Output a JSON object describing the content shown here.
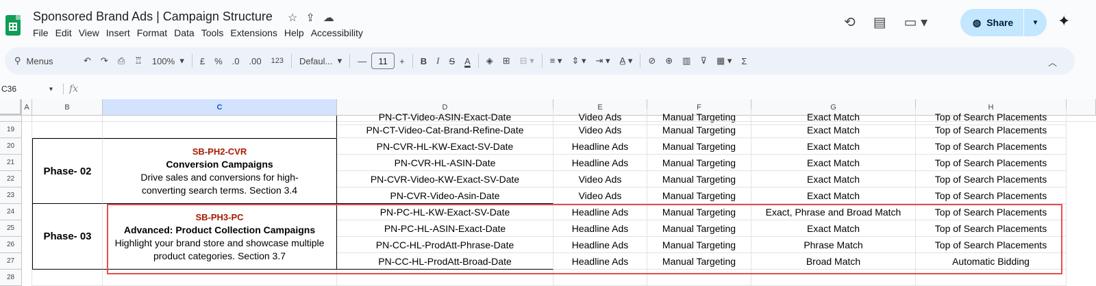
{
  "document": {
    "title": "Sponsored Brand Ads | Campaign Structure",
    "title_icons": [
      "star-icon",
      "move-to-folder-icon",
      "cloud-saved-icon"
    ]
  },
  "menu": [
    "File",
    "Edit",
    "View",
    "Insert",
    "Format",
    "Data",
    "Tools",
    "Extensions",
    "Help",
    "Accessibility"
  ],
  "header_actions": {
    "share_label": "Share",
    "icons": [
      "version-history-icon",
      "comments-icon",
      "meet-icon",
      "gemini-sparkle-icon"
    ]
  },
  "toolbar": {
    "menus_label": "Menus",
    "zoom": "100%",
    "currency": "£",
    "percent": "%",
    "decrease_decimal": ".0",
    "increase_decimal": ".00",
    "number_format": "123",
    "font_family": "Defaul...",
    "font_size": "11",
    "bold": "B",
    "italic": "I",
    "text_color": "A",
    "sum": "Σ"
  },
  "formula_bar": {
    "name_box": "C36",
    "fx": "fx"
  },
  "columns": [
    "A",
    "B",
    "C",
    "D",
    "E",
    "F",
    "G",
    "H"
  ],
  "selected_column": "C",
  "partial_row": {
    "ad_name": "PN-CT-Video-ASIN-Exact-Date",
    "ad_type": "Video Ads",
    "targeting": "Manual Targeting",
    "match": "Exact Match",
    "placement": "Top of Search Placements"
  },
  "rows": [
    {
      "num": "19",
      "ad_name": "PN-CT-Video-Cat-Brand-Refine-Date",
      "ad_type": "Video Ads",
      "targeting": "Manual Targeting",
      "match": "Exact Match",
      "placement": "Top of Search Placements"
    },
    {
      "num": "20",
      "ad_name": "PN-CVR-HL-KW-Exact-SV-Date",
      "ad_type": "Headline Ads",
      "targeting": "Manual Targeting",
      "match": "Exact Match",
      "placement": "Top of Search Placements"
    },
    {
      "num": "21",
      "ad_name": "PN-CVR-HL-ASIN-Date",
      "ad_type": "Headline Ads",
      "targeting": "Manual Targeting",
      "match": "Exact Match",
      "placement": "Top of Search Placements"
    },
    {
      "num": "22",
      "ad_name": "PN-CVR-Video-KW-Exact-SV-Date",
      "ad_type": "Video Ads",
      "targeting": "Manual Targeting",
      "match": "Exact Match",
      "placement": "Top of Search Placements"
    },
    {
      "num": "23",
      "ad_name": "PN-CVR-Video-Asin-Date",
      "ad_type": "Video Ads",
      "targeting": "Manual Targeting",
      "match": "Exact Match",
      "placement": "Top of Search Placements"
    },
    {
      "num": "24",
      "ad_name": "PN-PC-HL-KW-Exact-SV-Date",
      "ad_type": "Headline Ads",
      "targeting": "Manual Targeting",
      "match": "Exact, Phrase and Broad Match",
      "placement": "Top of Search Placements"
    },
    {
      "num": "25",
      "ad_name": "PN-PC-HL-ASIN-Exact-Date",
      "ad_type": "Headline Ads",
      "targeting": "Manual Targeting",
      "match": "Exact Match",
      "placement": "Top of Search Placements"
    },
    {
      "num": "26",
      "ad_name": "PN-CC-HL-ProdAtt-Phrase-Date",
      "ad_type": "Headline Ads",
      "targeting": "Manual Targeting",
      "match": "Phrase Match",
      "placement": "Top of Search Placements"
    },
    {
      "num": "27",
      "ad_name": "PN-CC-HL-ProdAtt-Broad-Date",
      "ad_type": "Headline Ads",
      "targeting": "Manual Targeting",
      "match": "Broad Match",
      "placement": "Automatic Bidding"
    },
    {
      "num": "28",
      "ad_name": "",
      "ad_type": "",
      "targeting": "",
      "match": "",
      "placement": ""
    }
  ],
  "phases": [
    {
      "label": "Phase- 02",
      "code": "SB-PH2-CVR",
      "title": "Conversion Campaigns",
      "desc_line1": "Drive sales and conversions for high-",
      "desc_line2": "converting search terms. Section 3.4"
    },
    {
      "label": "Phase- 03",
      "code": "SB-PH3-PC",
      "title": "Advanced: Product Collection Campaigns",
      "desc_line1": "Highlight your brand store and showcase multiple",
      "desc_line2": "product categories. Section 3.7"
    }
  ],
  "colors": {
    "campaign_code": "#a61c00",
    "highlight_box": "#e84b4b",
    "share_button": "#c2e7ff",
    "selected_header": "#d3e3fd"
  }
}
